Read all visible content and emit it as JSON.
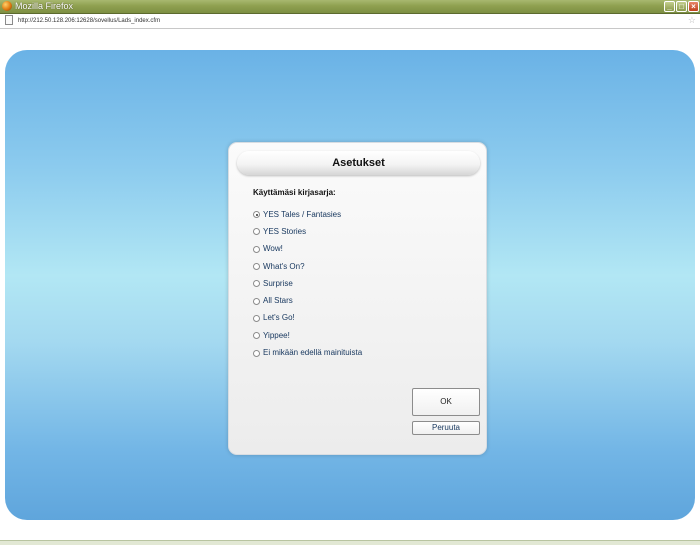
{
  "window": {
    "title": "Mozilla Firefox",
    "controls": [
      "_",
      "□",
      "×"
    ]
  },
  "address_bar": {
    "url": "http://212.50.128.206:12628/sovellus/Lads_index.cfm"
  },
  "dialog": {
    "title": "Asetukset",
    "prompt": "Käyttämäsi kirjasarja:",
    "options": [
      {
        "label": "YES Tales / Fantasies",
        "selected": true
      },
      {
        "label": "YES Stories",
        "selected": false
      },
      {
        "label": "Wow!",
        "selected": false
      },
      {
        "label": "What's On?",
        "selected": false
      },
      {
        "label": "Surprise",
        "selected": false
      },
      {
        "label": "All Stars",
        "selected": false
      },
      {
        "label": "Let's Go!",
        "selected": false
      },
      {
        "label": "Yippee!",
        "selected": false
      },
      {
        "label": "Ei mikään edellä mainituista",
        "selected": false
      }
    ],
    "ok_label": "OK",
    "cancel_label": "Peruuta"
  },
  "colors": {
    "background_top": "#6ab2e6",
    "background_mid": "#b2e7f4",
    "option_text": "#17375e"
  }
}
